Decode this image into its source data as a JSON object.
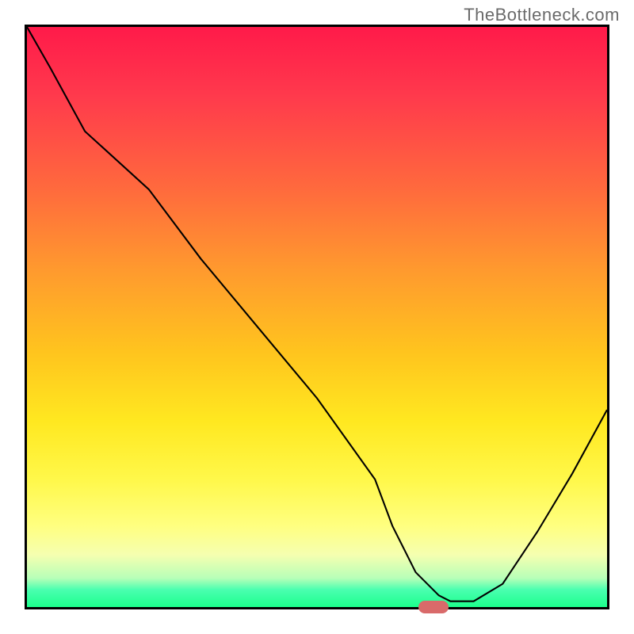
{
  "watermark": "TheBottleneck.com",
  "chart_data": {
    "type": "line",
    "title": "",
    "xlabel": "",
    "ylabel": "",
    "xlim": [
      0,
      100
    ],
    "ylim": [
      0,
      100
    ],
    "grid": false,
    "series": [
      {
        "name": "bottleneck-curve",
        "x": [
          0,
          4,
          10,
          21,
          30,
          40,
          50,
          60,
          63,
          67,
          71,
          73,
          77,
          82,
          88,
          94,
          100
        ],
        "values": [
          100,
          93,
          82,
          72,
          60,
          48,
          36,
          22,
          14,
          6,
          2,
          1,
          1,
          4,
          13,
          23,
          34
        ]
      }
    ],
    "marker": {
      "x": 69.5,
      "y": 0.8,
      "color": "#d96a6a"
    },
    "background_gradient": {
      "direction": "vertical",
      "stops": [
        {
          "pos": 0,
          "color": "#ff1a4a"
        },
        {
          "pos": 28,
          "color": "#ff6a3d"
        },
        {
          "pos": 56,
          "color": "#ffc41e"
        },
        {
          "pos": 78,
          "color": "#fff84a"
        },
        {
          "pos": 95,
          "color": "#b8ffb8"
        },
        {
          "pos": 100,
          "color": "#1cff8c"
        }
      ]
    }
  }
}
